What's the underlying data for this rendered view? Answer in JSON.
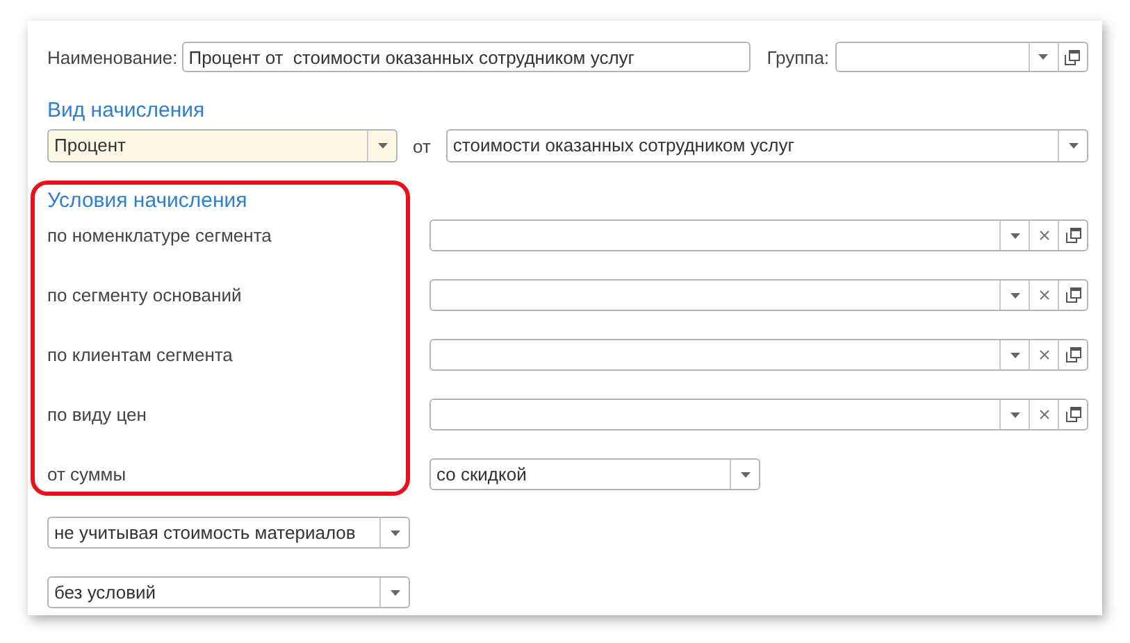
{
  "name_field": {
    "label": "Наименование:",
    "value": "Процент от  стоимости оказанных сотрудником услуг"
  },
  "group_field": {
    "label": "Группа:"
  },
  "accrual_type": {
    "heading": "Вид начисления",
    "type": {
      "value": "Процент",
      "focused": true
    },
    "connector": "от",
    "base": {
      "value": "стоимости оказанных сотрудником услуг",
      "focused": false
    }
  },
  "conditions": {
    "heading": "Условия начисления",
    "rows": [
      {
        "label": "по номенклатуре сегмента",
        "kind": "reference"
      },
      {
        "label": "по сегменту оснований",
        "kind": "reference"
      },
      {
        "label": "по клиентам сегмента",
        "kind": "reference"
      },
      {
        "label": "по виду цен",
        "kind": "reference"
      },
      {
        "label": "от суммы",
        "kind": "select",
        "value": "со скидкой"
      }
    ]
  },
  "extra_selects": [
    {
      "value": "не учитывая стоимость материалов"
    },
    {
      "value": "без условий"
    }
  ]
}
